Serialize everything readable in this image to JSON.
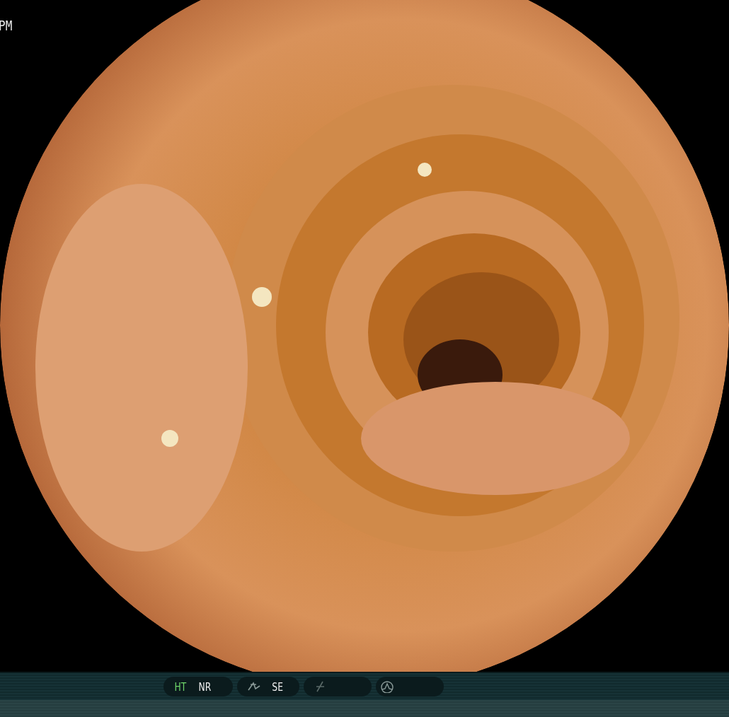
{
  "overlay": {
    "time_suffix": "PM"
  },
  "status_bar": {
    "groups": [
      {
        "items": [
          {
            "kind": "text",
            "label": "HT",
            "on": true
          },
          {
            "kind": "text",
            "label": "NR",
            "on": false
          }
        ]
      },
      {
        "items": [
          {
            "kind": "curve-icon"
          },
          {
            "kind": "text",
            "label": "SE",
            "on": false
          }
        ]
      },
      {
        "items": [
          {
            "kind": "slash-icon"
          }
        ]
      },
      {
        "items": [
          {
            "kind": "wave-icon"
          }
        ]
      }
    ]
  }
}
